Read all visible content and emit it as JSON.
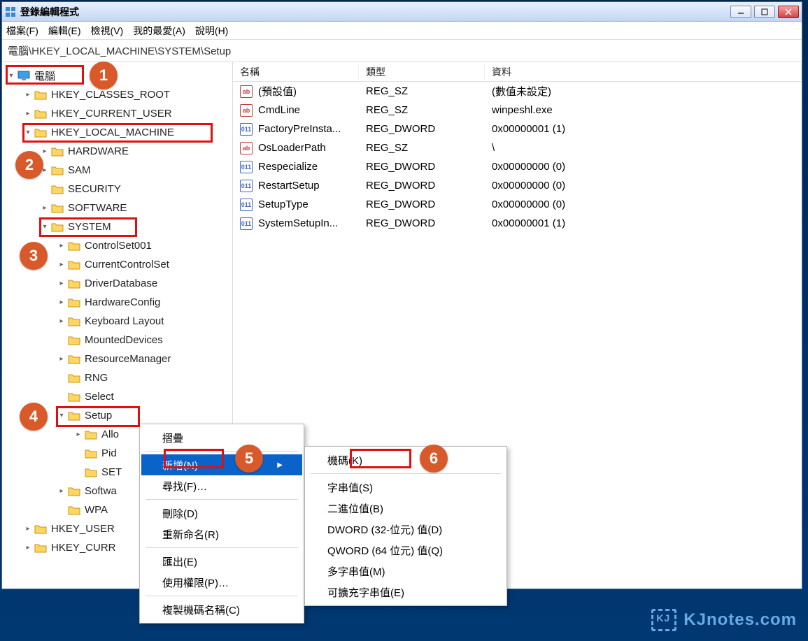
{
  "window": {
    "title": "登錄編輯程式"
  },
  "menu": {
    "file": "檔案(F)",
    "edit": "編輯(E)",
    "view": "檢視(V)",
    "favorites": "我的最愛(A)",
    "help": "說明(H)"
  },
  "address": "電腦\\HKEY_LOCAL_MACHINE\\SYSTEM\\Setup",
  "tree": {
    "computer": "電腦",
    "hkcr": "HKEY_CLASSES_ROOT",
    "hkcu": "HKEY_CURRENT_USER",
    "hklm": "HKEY_LOCAL_MACHINE",
    "hardware": "HARDWARE",
    "sam": "SAM",
    "security": "SECURITY",
    "software": "SOFTWARE",
    "system": "SYSTEM",
    "cs001": "ControlSet001",
    "ccs": "CurrentControlSet",
    "driverdb": "DriverDatabase",
    "hwconfig": "HardwareConfig",
    "kblayout": "Keyboard Layout",
    "mounted": "MountedDevices",
    "resmgr": "ResourceManager",
    "rng": "RNG",
    "select": "Select",
    "setup": "Setup",
    "allo": "Allo",
    "pid": "Pid",
    "set": "SET",
    "softwa": "Softwa",
    "wpa": "WPA",
    "hku": "HKEY_USER",
    "hkcc": "HKEY_CURR"
  },
  "columns": {
    "name": "名稱",
    "type": "類型",
    "data": "資料"
  },
  "values": [
    {
      "icon": "sz",
      "name": "(預設值)",
      "type": "REG_SZ",
      "data": "(數值未設定)"
    },
    {
      "icon": "sz",
      "name": "CmdLine",
      "type": "REG_SZ",
      "data": "winpeshl.exe"
    },
    {
      "icon": "dw",
      "name": "FactoryPreInsta...",
      "type": "REG_DWORD",
      "data": "0x00000001 (1)"
    },
    {
      "icon": "sz",
      "name": "OsLoaderPath",
      "type": "REG_SZ",
      "data": "\\"
    },
    {
      "icon": "dw",
      "name": "Respecialize",
      "type": "REG_DWORD",
      "data": "0x00000000 (0)"
    },
    {
      "icon": "dw",
      "name": "RestartSetup",
      "type": "REG_DWORD",
      "data": "0x00000000 (0)"
    },
    {
      "icon": "dw",
      "name": "SetupType",
      "type": "REG_DWORD",
      "data": "0x00000000 (0)"
    },
    {
      "icon": "dw",
      "name": "SystemSetupIn...",
      "type": "REG_DWORD",
      "data": "0x00000001 (1)"
    }
  ],
  "context_menu1": {
    "collapse": "摺疊",
    "new": "新增(N)",
    "find": "尋找(F)…",
    "delete": "刪除(D)",
    "rename": "重新命名(R)",
    "export": "匯出(E)",
    "permissions": "使用權限(P)…",
    "copykey": "複製機碼名稱(C)"
  },
  "context_menu2": {
    "key": "機碼(K)",
    "string": "字串值(S)",
    "binary": "二進位值(B)",
    "dword": "DWORD (32-位元) 值(D)",
    "qword": "QWORD (64 位元) 值(Q)",
    "multi": "多字串值(M)",
    "expand": "可擴充字串值(E)"
  },
  "annotations": {
    "n1": "1",
    "n2": "2",
    "n3": "3",
    "n4": "4",
    "n5": "5",
    "n6": "6"
  },
  "watermark": "KJnotes.com"
}
